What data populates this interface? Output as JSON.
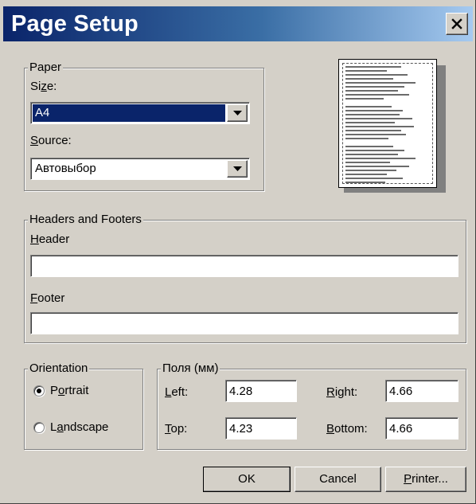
{
  "window": {
    "title": "Page Setup",
    "close_glyph": "✕",
    "close_icon": "close-icon"
  },
  "paper": {
    "legend": "Paper",
    "size_label_pre": "Si",
    "size_label_key": "z",
    "size_label_post": "e:",
    "size_value": "A4",
    "source_label_key": "S",
    "source_label_post": "ource:",
    "source_value": "Автовыбор"
  },
  "headers": {
    "legend": "Headers and Footers",
    "header_label_key": "H",
    "header_label_post": "eader",
    "header_value": "",
    "footer_label_key": "F",
    "footer_label_post": "ooter",
    "footer_value": ""
  },
  "orientation": {
    "legend": "Orientation",
    "portrait_pre": "P",
    "portrait_key": "o",
    "portrait_post": "rtrait",
    "portrait_checked": true,
    "landscape_pre": "L",
    "landscape_key": "a",
    "landscape_post": "ndscape",
    "landscape_checked": false
  },
  "margins": {
    "legend": "Поля (мм)",
    "left_key": "L",
    "left_post": "eft:",
    "left_value": "4.28",
    "right_key": "R",
    "right_post": "ight:",
    "right_value": "4.66",
    "top_key": "T",
    "top_post": "op:",
    "top_value": "4.23",
    "bottom_key": "B",
    "bottom_post": "ottom:",
    "bottom_value": "4.66"
  },
  "buttons": {
    "ok": "OK",
    "cancel": "Cancel",
    "printer_key": "P",
    "printer_post": "rinter..."
  },
  "colors": {
    "dialog_bg": "#d4d0c8",
    "title_gradient_start": "#0a246a",
    "title_gradient_end": "#a6caf0",
    "selection": "#0a246a"
  }
}
